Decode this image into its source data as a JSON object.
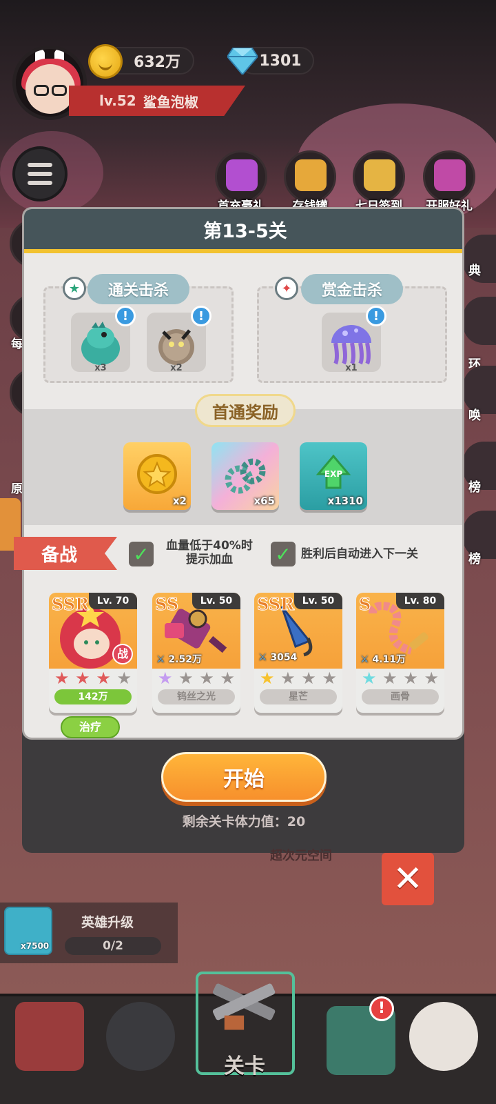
{
  "header": {
    "gold": "632万",
    "gems": "1301",
    "level": "lv.52",
    "player_name": "鲨鱼泡椒"
  },
  "events": [
    {
      "label": "首充豪礼",
      "icon": "gift-icon"
    },
    {
      "label": "存钱罐",
      "icon": "piggy-bank-icon"
    },
    {
      "label": "七日签到",
      "icon": "checkin-icon"
    },
    {
      "label": "开服好礼",
      "icon": "gift-box-icon"
    }
  ],
  "side_labels": {
    "left1": "每",
    "left2": "原",
    "right1": "典",
    "right2": "环",
    "right3": "唤",
    "right4": "榜",
    "right5": "榜"
  },
  "modal": {
    "title": "第13-5关",
    "clear_kill": {
      "title": "通关击杀",
      "monsters": [
        {
          "icon": "green-dragon-icon",
          "count": "x3"
        },
        {
          "icon": "furball-bird-icon",
          "count": "x2"
        }
      ]
    },
    "bounty_kill": {
      "title": "赏金击杀",
      "monsters": [
        {
          "icon": "jellyfish-icon",
          "count": "x1"
        }
      ]
    },
    "first_clear": {
      "title": "首通奖励",
      "rewards": [
        {
          "icon": "gold-coin-icon",
          "qty": "x2"
        },
        {
          "icon": "gear-icon",
          "qty": "x65"
        },
        {
          "icon": "exp-potion-icon",
          "qty": "x1310"
        }
      ]
    },
    "prep": {
      "tag": "备战",
      "opt1": "血量低于40%时提示加血",
      "opt1_line1": "血量低于40%时",
      "opt1_line2": "提示加血",
      "opt2": "胜利后自动进入下一关"
    },
    "heroes": [
      {
        "rank": "SSR",
        "level": "Lv. 70",
        "power": "",
        "stars_filled": 3,
        "bar": "142万",
        "badge": "战",
        "star_color": "#e05a5a"
      },
      {
        "rank": "SS",
        "level": "Lv. 50",
        "power": "2.52万",
        "stars_filled": 1,
        "bar": "钨丝之光",
        "badge": "",
        "star_color": "#c49cf0"
      },
      {
        "rank": "SSR",
        "level": "Lv. 50",
        "power": "3054",
        "stars_filled": 1,
        "bar": "星芒",
        "badge": "",
        "star_color": "#f7c22e"
      },
      {
        "rank": "S",
        "level": "Lv. 80",
        "power": "4.11万",
        "stars_filled": 1,
        "bar": "画骨",
        "badge": "",
        "star_color": "#6fdbe0"
      }
    ],
    "heal_label": "治疗"
  },
  "start_label": "开始",
  "stamina_text": "剩余关卡体力值：20",
  "behind_text": "超次元空间",
  "upgrade": {
    "title": "英雄升级",
    "progress": "0/2",
    "qty": "x7500"
  },
  "nav": {
    "center_label": "关卡",
    "items": [
      "shop-icon",
      "hero-icon",
      "stage-icon",
      "treasure-icon",
      "skull-icon"
    ]
  }
}
